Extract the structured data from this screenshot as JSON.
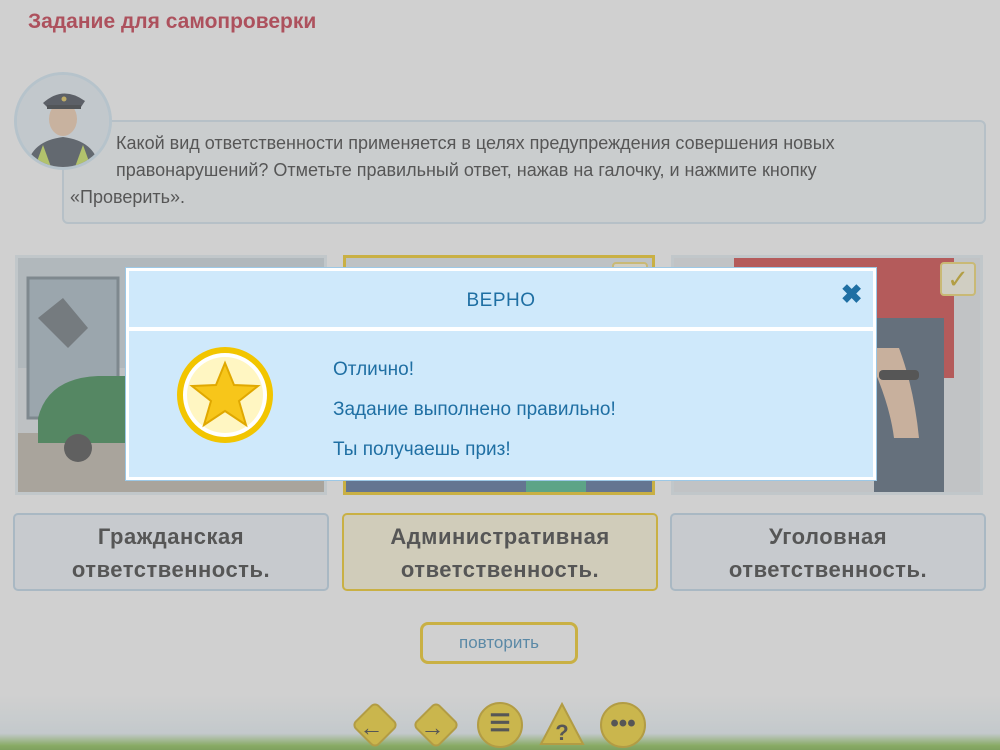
{
  "page": {
    "title": "Задание для самопроверки"
  },
  "question": {
    "line1": "Какой вид ответственности применяется в целях предупреждения совершения новых",
    "line2": "правонарушений? Отметьте правильный ответ, нажав на галочку, и нажмите кнопку",
    "line3": "«Проверить»."
  },
  "answers": [
    {
      "line1": "Гражданская",
      "line2": "ответственность.",
      "selected": false
    },
    {
      "line1": "Административная",
      "line2": "ответственность.",
      "selected": true
    },
    {
      "line1": "Уголовная",
      "line2": "ответственность.",
      "selected": false
    }
  ],
  "repeat_button": "повторить",
  "dialog": {
    "title": "ВЕРНО",
    "close_icon": "close-icon",
    "message1": "Отлично!",
    "message2": "Задание выполнено правильно!",
    "message3": "Ты получаешь приз!",
    "star_icon": "star-icon"
  },
  "nav": {
    "prev_icon": "arrow-left-icon",
    "next_icon": "arrow-right-icon",
    "menu_icon": "list-icon",
    "help_icon": "question-icon",
    "more_icon": "more-icon"
  },
  "colors": {
    "title": "#c0182f",
    "accent_yellow": "#f2c500",
    "dialog_bg": "#cfe9fb",
    "dialog_text": "#1f6fa3"
  }
}
